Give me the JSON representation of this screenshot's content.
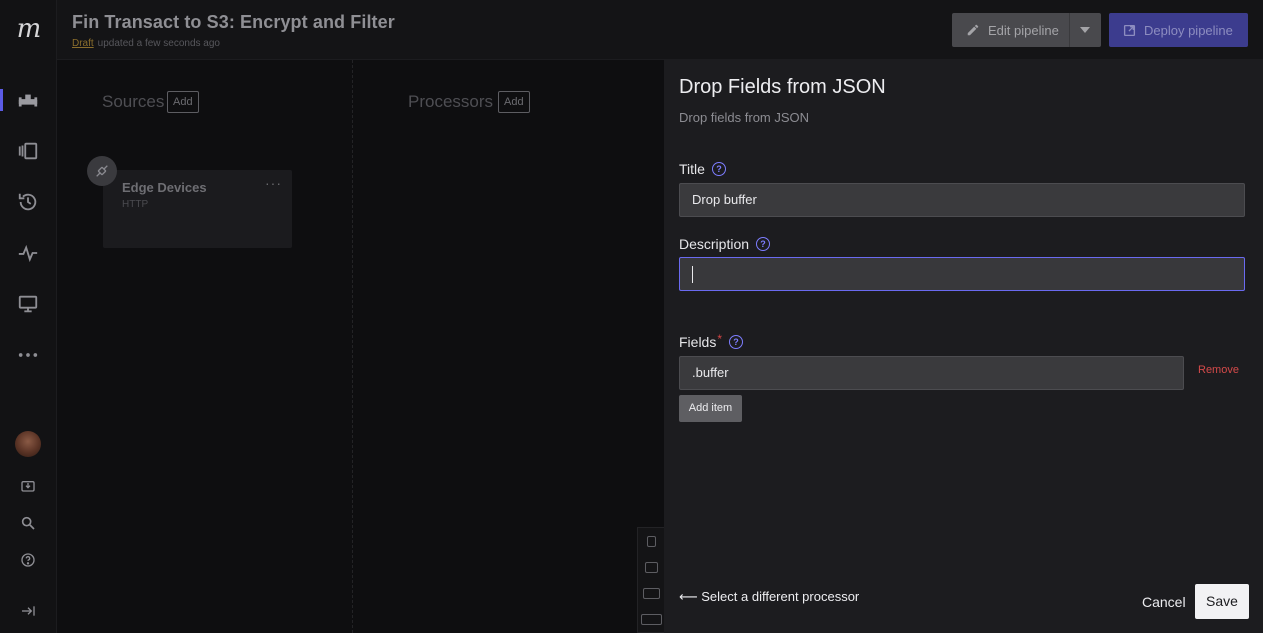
{
  "header": {
    "title": "Fin Transact to S3: Encrypt and Filter",
    "status_draft": "Draft",
    "status_updated": "updated a few seconds ago",
    "edit_label": "Edit pipeline",
    "deploy_label": "Deploy pipeline"
  },
  "rail": {
    "logo": "m",
    "icons": [
      "pipelines-icon",
      "library-icon",
      "history-icon",
      "activity-icon",
      "monitor-icon",
      "more-icon",
      "avatar",
      "download-icon",
      "search-icon",
      "help-icon",
      "collapse-icon"
    ]
  },
  "canvas": {
    "sources_label": "Sources",
    "processors_label": "Processors",
    "add_label": "Add",
    "node": {
      "title": "Edge Devices",
      "subtitle": "HTTP",
      "menu": "···"
    }
  },
  "panel": {
    "title": "Drop Fields from JSON",
    "subtitle": "Drop fields from JSON",
    "title_field": {
      "label": "Title",
      "value": "Drop buffer"
    },
    "description_field": {
      "label": "Description",
      "value": ""
    },
    "fields_field": {
      "label": "Fields",
      "required_mark": "*",
      "items": [
        ".buffer"
      ],
      "remove_label": "Remove",
      "add_label": "Add item"
    },
    "back_label": "⟵ Select a different processor",
    "cancel_label": "Cancel",
    "save_label": "Save"
  },
  "colors": {
    "accent": "#5b5be6",
    "help_icon": "#7d7dff",
    "danger": "#d44a4a",
    "draft": "#8a6d2c"
  }
}
